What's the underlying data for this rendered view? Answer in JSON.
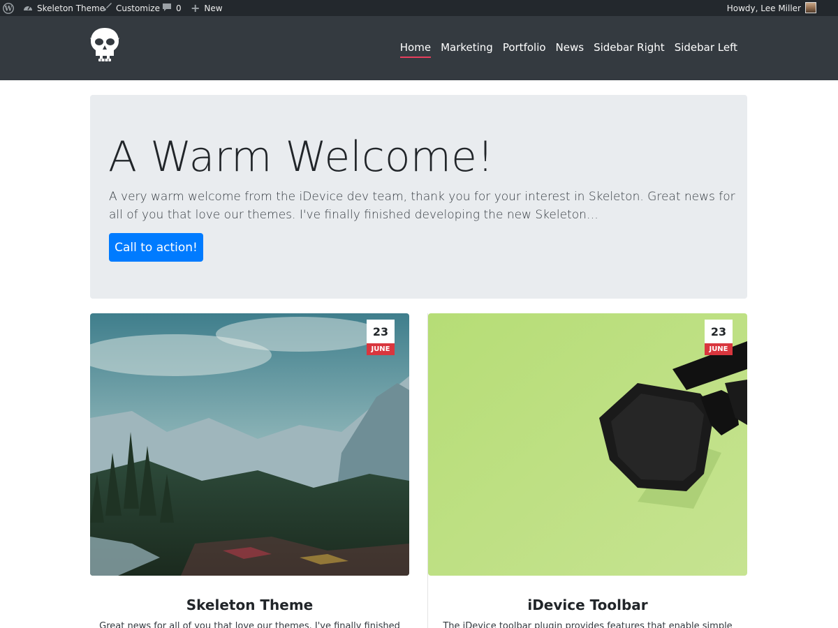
{
  "admin_bar": {
    "site_name": "Skeleton Theme",
    "customize": "Customize",
    "comments_count": "0",
    "new": "New",
    "howdy": "Howdy, Lee Miller"
  },
  "nav": {
    "items": [
      "Home",
      "Marketing",
      "Portfolio",
      "News",
      "Sidebar Right",
      "Sidebar Left"
    ],
    "active": "Home",
    "accent_color": "#e83e5c"
  },
  "hero": {
    "title": "A Warm Welcome!",
    "text": "A very warm welcome from the iDevice dev team, thank you for your interest in Skeleton. Great news for all of you that love our themes. I've finally finished developing the new Skeleton…",
    "cta_label": "Call to action!",
    "cta_color": "#007bff"
  },
  "posts": [
    {
      "day": "23",
      "month": "JUNE",
      "title": "Skeleton Theme",
      "excerpt": "Great news for all of you that love our themes. I've finally finished"
    },
    {
      "day": "23",
      "month": "JUNE",
      "title": "iDevice Toolbar",
      "excerpt": "The iDevice toolbar plugin provides features that enable simple"
    }
  ]
}
